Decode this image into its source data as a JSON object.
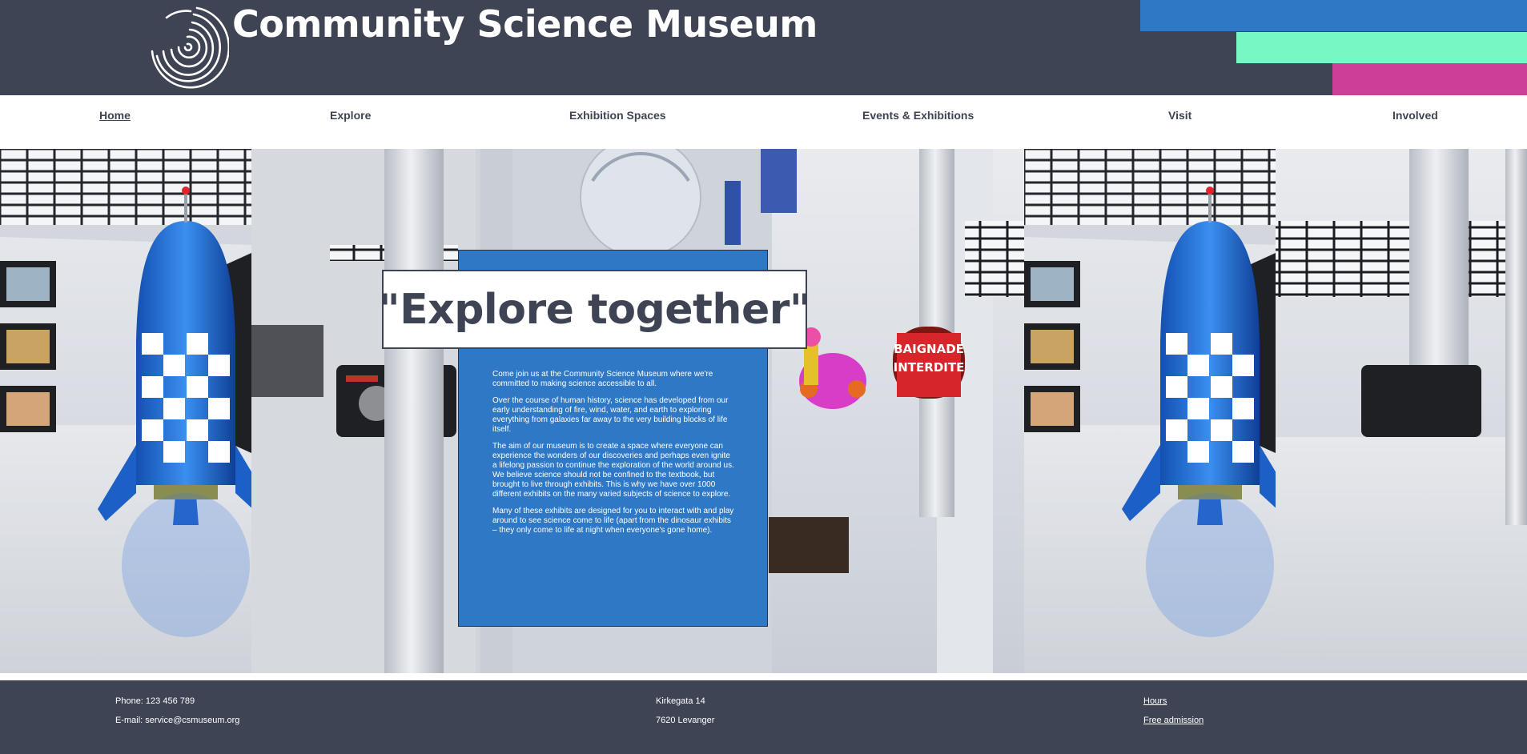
{
  "header": {
    "title": "Community Science Museum",
    "colors": {
      "background": "#3e4453",
      "blue": "#2f78c5",
      "mint": "#76f7c4",
      "pink": "#cc3e97"
    },
    "logo_icon": "spiral-logo-icon"
  },
  "nav": {
    "items": [
      {
        "label": "Home",
        "active": true
      },
      {
        "label": "Explore"
      },
      {
        "label": "Exhibition Spaces"
      },
      {
        "label": "Events & Exhibitions"
      },
      {
        "label": "Visit"
      },
      {
        "label": "Involved"
      }
    ]
  },
  "hero": {
    "tagline": "\"Explore together\"",
    "paragraphs": [
      "Come join us at the Community Science Museum where we're committed to making science accessible to all.",
      "Over the course of human history, science has developed from our early understanding of fire, wind, water, and earth to exploring everything from galaxies far away to the very building blocks of life itself.",
      "The aim of our museum is to create a space where everyone can experience the wonders of our discoveries and perhaps even ignite a lifelong passion to continue the exploration of the world around us. We believe science should not be confined to the textbook, but brought to live through exhibits. This is why we have over 1000 different exhibits on the many varied subjects of science to explore.",
      "Many of these exhibits are designed for you to interact with and play around to see science come to life (apart from the dinosaur exhibits – they only come to life at night when everyone's gone home)."
    ],
    "image_text": {
      "sign": "BAIGNADE INTERDITE"
    }
  },
  "footer": {
    "phone": "Phone: 123 456 789",
    "email": "E-mail: service@csmuseum.org",
    "street": "Kirkegata 14",
    "city": "7620 Levanger",
    "hours_link": "Hours",
    "admission_link": "Free admission"
  }
}
